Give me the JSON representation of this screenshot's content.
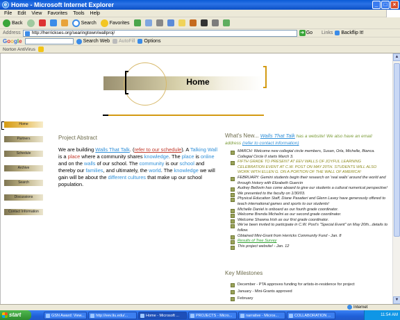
{
  "window": {
    "title": "Home - Microsoft Internet Explorer",
    "minimize": "_",
    "maximize": "□",
    "close": "×"
  },
  "menu": [
    "File",
    "Edit",
    "View",
    "Favorites",
    "Tools",
    "Help"
  ],
  "toolbar": {
    "back": "Back",
    "search": "Search",
    "favorites": "Favorites"
  },
  "address": {
    "label": "Address",
    "url": "http://herrickses.org/searingtown/wallproj/",
    "go": "Go",
    "links": "Links",
    "backflip": "Backflip It!"
  },
  "google": {
    "logo": "Google",
    "search_web": "Search Web",
    "autofill": "AutoFill",
    "options": "Options"
  },
  "norton": {
    "label": "Norton AntiVirus"
  },
  "page": {
    "title": "Home",
    "nav": [
      {
        "label": "Home",
        "active": true
      },
      {
        "label": "Partners",
        "active": false
      },
      {
        "label": "Schedule",
        "active": false
      },
      {
        "label": "Archive",
        "active": false
      },
      {
        "label": "Search",
        "active": false
      },
      {
        "label": "Discussions",
        "active": false
      },
      {
        "label": "Contact Information",
        "active": false
      }
    ],
    "abstract": {
      "title": "Project Abstract",
      "p1": "We are building ",
      "link_walls": "Walls That Talk",
      "p2": ". (",
      "link_schedule": "refer to our schedule",
      "p3": "). A ",
      "k_talking": "Talking",
      "k_wall": "Wall",
      "p4": " is a ",
      "r_place": "place",
      "p5": " where a community shares ",
      "k_knowledge": "knowledge",
      "p6": ". The ",
      "k_place": "place",
      "p7": " is ",
      "k_online": "online",
      "p8": " and on the ",
      "k_walls": "walls",
      "p9": " of our school. The ",
      "k_community": "community",
      "p10": " is our ",
      "k_school": "school",
      "p11": " and thereby our ",
      "k_families": "families",
      "p12": ", and ultimately, the ",
      "k_world": "world",
      "p13": ". The ",
      "k_knowledge2": "knowledge",
      "p14": " we will gain will be about the ",
      "k_cultures": "different cultures",
      "p15": " that make up our school population."
    },
    "whats_new": {
      "title": "What's New...",
      "head_link": "Walls That Talk",
      "head_text": " has a website! We also have an email address ",
      "head_link2": "(refer to contact information)",
      "items": [
        {
          "text": "MARCH: Welcome new collegial circle members, Susan, Orla, Michelle, Bianca. Collegial Circle II starts March 3.",
          "style": "normal"
        },
        {
          "text": "FIFTH GRADE TO PRESENT AT EEV WALLS OF JOYFUL LEARNING CELEBRATION EVENT AT C.W. POST ON MAY 20TH. STUDENTS WILL ALSO WORK WITH ELLEN G. ON A PORTION OF THE WALL OF AMERICA!",
          "style": "gold"
        },
        {
          "text": "FEBRUARY: Gemini students begin their research on 'real walls' around the world and through history with Elizabeth Guercin",
          "style": "normal"
        },
        {
          "text": "Audrey Bellovin has come aboard to give our students a cultural numerical perspective!",
          "style": "normal"
        },
        {
          "text": "We presented to the faculty on 1/30/03.",
          "style": "normal"
        },
        {
          "text": "Physical Education Staff, Diane Pasatieri and Glenn Lavey have generously offered to teach international games and sports to our students!",
          "style": "normal"
        },
        {
          "text": "Michelle Daniel is onboard as our fourth grade coordinator.",
          "style": "normal"
        },
        {
          "text": "Welcome Brenda Michelini as our second grade coordinator.",
          "style": "normal"
        },
        {
          "text": "Welcome Shawna Irish as our first grade coordinator.",
          "style": "normal"
        },
        {
          "text": "We've been invited to participate in C.W. Post's \"Special Event\" on May 20th...details to follow.",
          "style": "normal"
        },
        {
          "text": "Obtained Mini-Grant from Herricks Community Fund - Jan. 8",
          "style": "normal"
        },
        {
          "text": "Results of Tree Survey",
          "style": "link"
        },
        {
          "text": "This project website! - Jan. 12",
          "style": "normal"
        }
      ]
    },
    "milestones": {
      "title": "Key Milestones",
      "items": [
        "December - PTA approves funding for artists-in-residence for project",
        "January - Mini-Grants approved",
        "February"
      ]
    }
  },
  "status": {
    "zone": "Internet"
  },
  "taskbar": {
    "start": "start",
    "items": [
      {
        "label": "GSN Award: View...",
        "active": false
      },
      {
        "label": "http://eev.liu.edu/...",
        "active": false
      },
      {
        "label": "Home - Microsoft ...",
        "active": true
      },
      {
        "label": "PROJECTS - Micro...",
        "active": false
      },
      {
        "label": "narrative - Micros...",
        "active": false
      },
      {
        "label": "COLLABORATION ...",
        "active": false
      }
    ],
    "clock": "11:54 AM"
  }
}
